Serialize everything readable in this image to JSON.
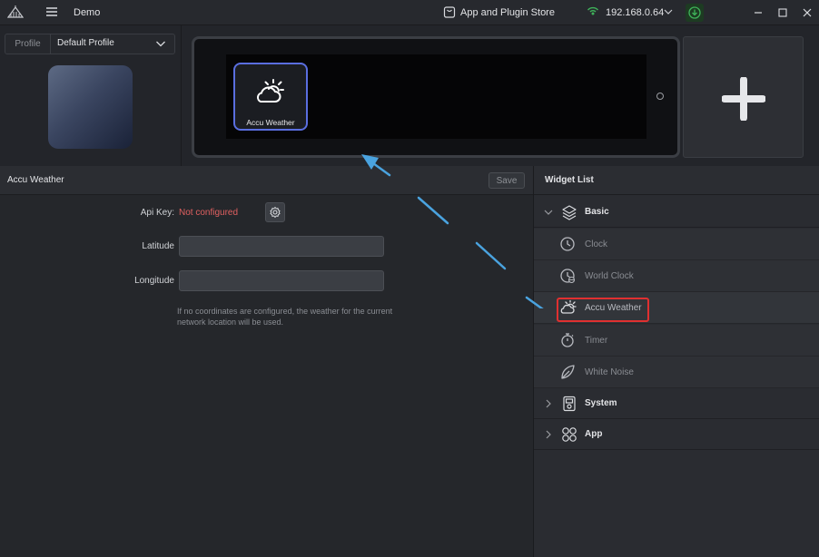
{
  "titlebar": {
    "app_name": "Demo",
    "store_label": "App and Plugin Store",
    "ip_address": "192.168.0.64"
  },
  "profile": {
    "label": "Profile",
    "selected": "Default Profile"
  },
  "device": {
    "widget_label": "Accu Weather"
  },
  "editor": {
    "title": "Accu Weather",
    "save_label": "Save",
    "api_key_label": "Api Key:",
    "api_key_status": "Not configured",
    "latitude_label": "Latitude",
    "longitude_label": "Longitude",
    "latitude_value": "",
    "longitude_value": "",
    "hint": "If no coordinates are configured, the weather for the current network location will be used."
  },
  "widget_list": {
    "title": "Widget List",
    "categories": [
      {
        "label": "Basic",
        "expanded": true,
        "items": [
          {
            "label": "Clock",
            "icon": "clock-icon"
          },
          {
            "label": "World Clock",
            "icon": "world-clock-icon"
          },
          {
            "label": "Accu Weather",
            "icon": "weather-icon",
            "selected": true
          },
          {
            "label": "Timer",
            "icon": "timer-icon"
          },
          {
            "label": "White Noise",
            "icon": "leaf-icon"
          }
        ]
      },
      {
        "label": "System",
        "expanded": false
      },
      {
        "label": "App",
        "expanded": false
      }
    ]
  },
  "colors": {
    "accent_blue": "#5a6ee0",
    "warning_red": "#e06060",
    "highlight_red": "#e03030",
    "status_green": "#3fb35a",
    "arrow_blue": "#4aa3df"
  }
}
